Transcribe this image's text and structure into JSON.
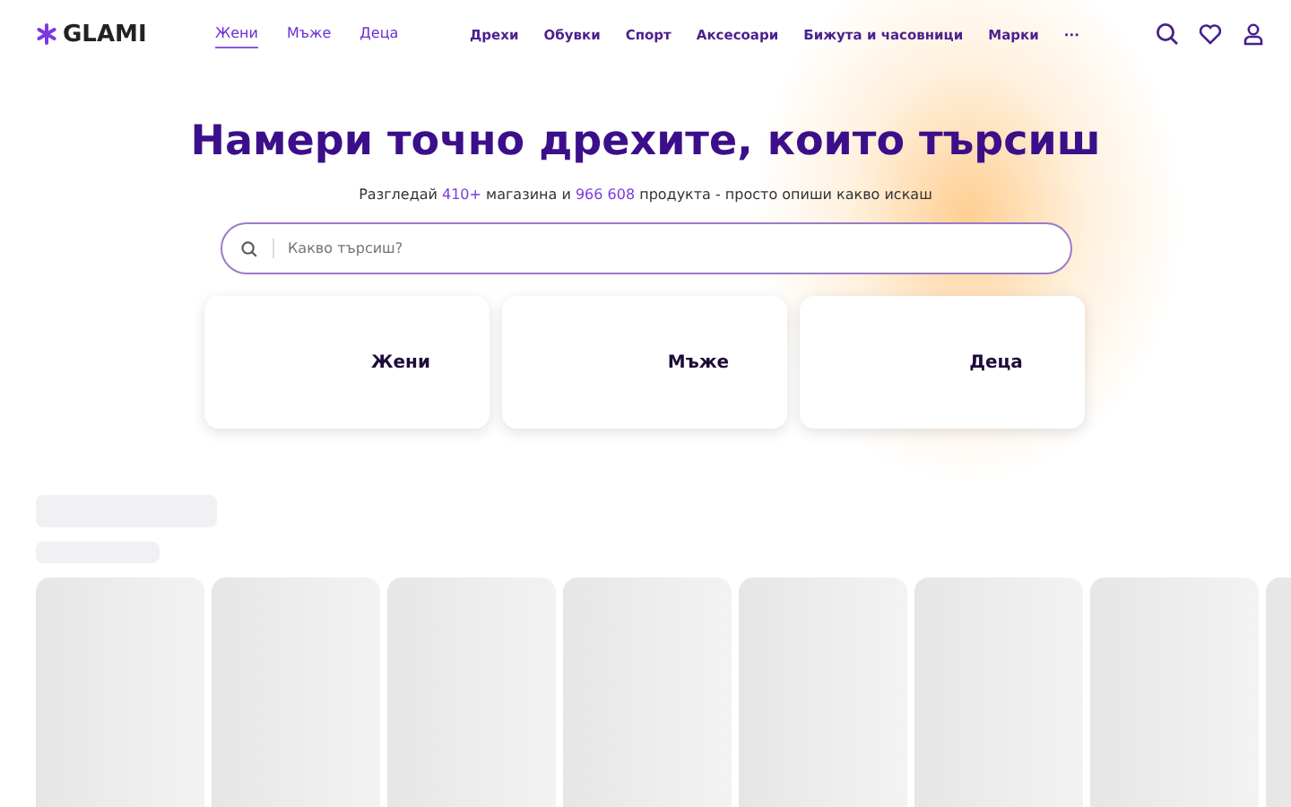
{
  "logo": "GLAMI",
  "gender_tabs": [
    {
      "label": "Жени",
      "selected": true
    },
    {
      "label": "Мъже",
      "selected": false
    },
    {
      "label": "Деца",
      "selected": false
    }
  ],
  "categories": [
    "Дрехи",
    "Обувки",
    "Спорт",
    "Аксесоари",
    "Бижута и часовници",
    "Марки",
    "···"
  ],
  "hero": {
    "title": "Намери точно дрехите, които търсиш",
    "subtitle": "Разгледай **410+** магазина и **966 608** продукта - просто опиши какво искаш"
  },
  "search": {
    "placeholder": "Какво търсиш?"
  },
  "gender_cards": [
    "Жени",
    "Мъже",
    "Деца"
  ]
}
